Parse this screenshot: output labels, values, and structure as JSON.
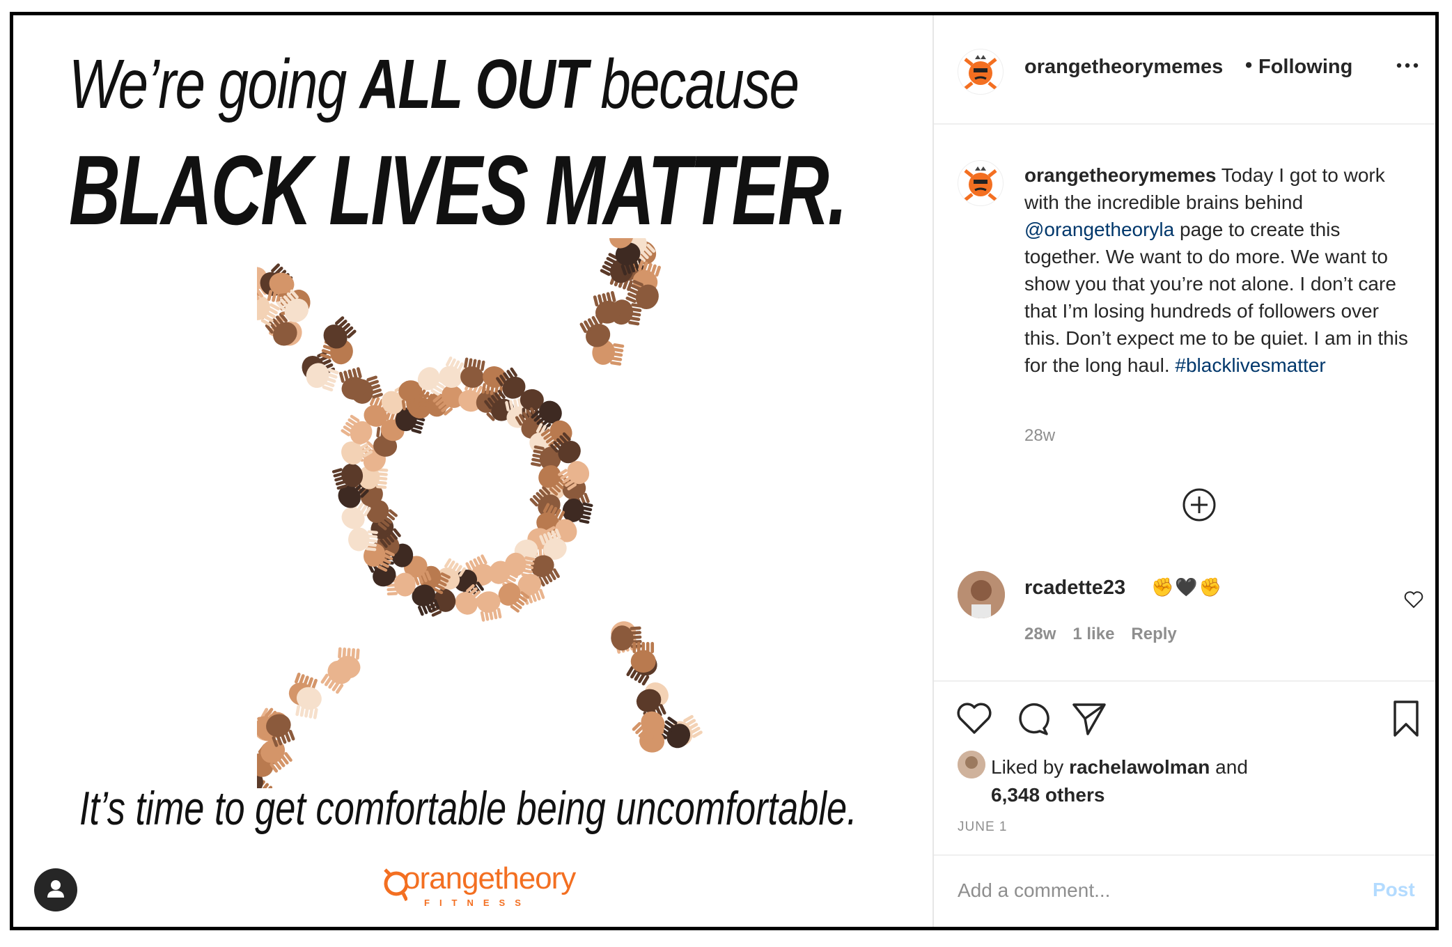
{
  "post_image": {
    "headline_line1_regular": "We’re going ",
    "headline_line1_bold": "ALL OUT",
    "headline_line1_end": " because",
    "headline_line2": "BLACK LIVES MATTER.",
    "tagline": "It’s time to get comfortable being uncomfortable.",
    "brand_name": "orangetheory",
    "brand_sub": "FITNESS",
    "brand_color": "#f36f21"
  },
  "header": {
    "username": "orangetheorymemes",
    "separator": "•",
    "follow_status": "Following",
    "more_icon": "more-horizontal-icon"
  },
  "caption": {
    "username": "orangetheorymemes",
    "text_1": " Today I got to work with the incredible brains behind ",
    "mention": "@orangetheoryla",
    "text_2": " page to create this together. We want to do more. We want to show you that you’re not alone. I don’t care that I’m losing hundreds of followers over this. Don’t expect me to be quiet. I am in this for the long haul. ",
    "hashtag": "#blacklivesmatter",
    "time": "28w"
  },
  "load_more_icon": "plus-circle-icon",
  "comment": {
    "username": "rcadette23",
    "emoji": "✊🖤✊",
    "time": "28w",
    "likes": "1 like",
    "reply": "Reply"
  },
  "actions": {
    "like_icon": "heart-icon",
    "comment_icon": "speech-bubble-icon",
    "share_icon": "paper-plane-icon",
    "save_icon": "bookmark-icon"
  },
  "likes": {
    "prefix": "Liked by ",
    "user": "rachelawolman",
    "middle": " and",
    "others": "6,348 others"
  },
  "post_date": "JUNE 1",
  "comment_input": {
    "placeholder": "Add a comment...",
    "post_label": "Post"
  }
}
